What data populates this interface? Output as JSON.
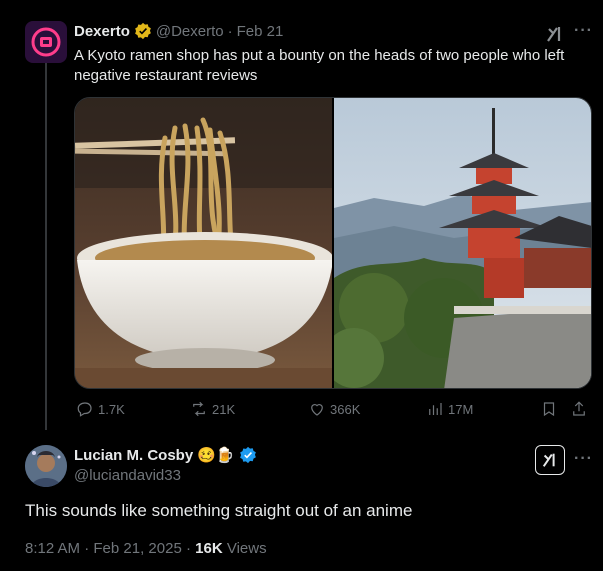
{
  "parent_tweet": {
    "author_name": "Dexerto",
    "handle": "@Dexerto",
    "separator": "·",
    "date": "Feb 21",
    "text": "A Kyoto ramen shop has put a bounty on the heads of two people who left negative restaurant reviews",
    "media": [
      {
        "icon": "ramen-photo"
      },
      {
        "icon": "pagoda-photo"
      }
    ],
    "actions": {
      "replies": "1.7K",
      "reposts": "21K",
      "likes": "366K",
      "views": "17M"
    }
  },
  "main_tweet": {
    "author_name": "Lucian M. Cosby",
    "emoji": "🥴🍺",
    "handle": "@luciandavid33",
    "text": "This sounds like something straight out of an anime",
    "time": "8:12 AM",
    "date_sep": "·",
    "date": "Feb 21, 2025",
    "date_views_sep": "·",
    "views_count": "16K",
    "views_label": "Views"
  },
  "colors": {
    "background": "#000000",
    "text_primary": "#e7e9ea",
    "text_muted": "#71767b",
    "verified_blue": "#1d9bf0",
    "verified_gold": "#e2b719"
  }
}
